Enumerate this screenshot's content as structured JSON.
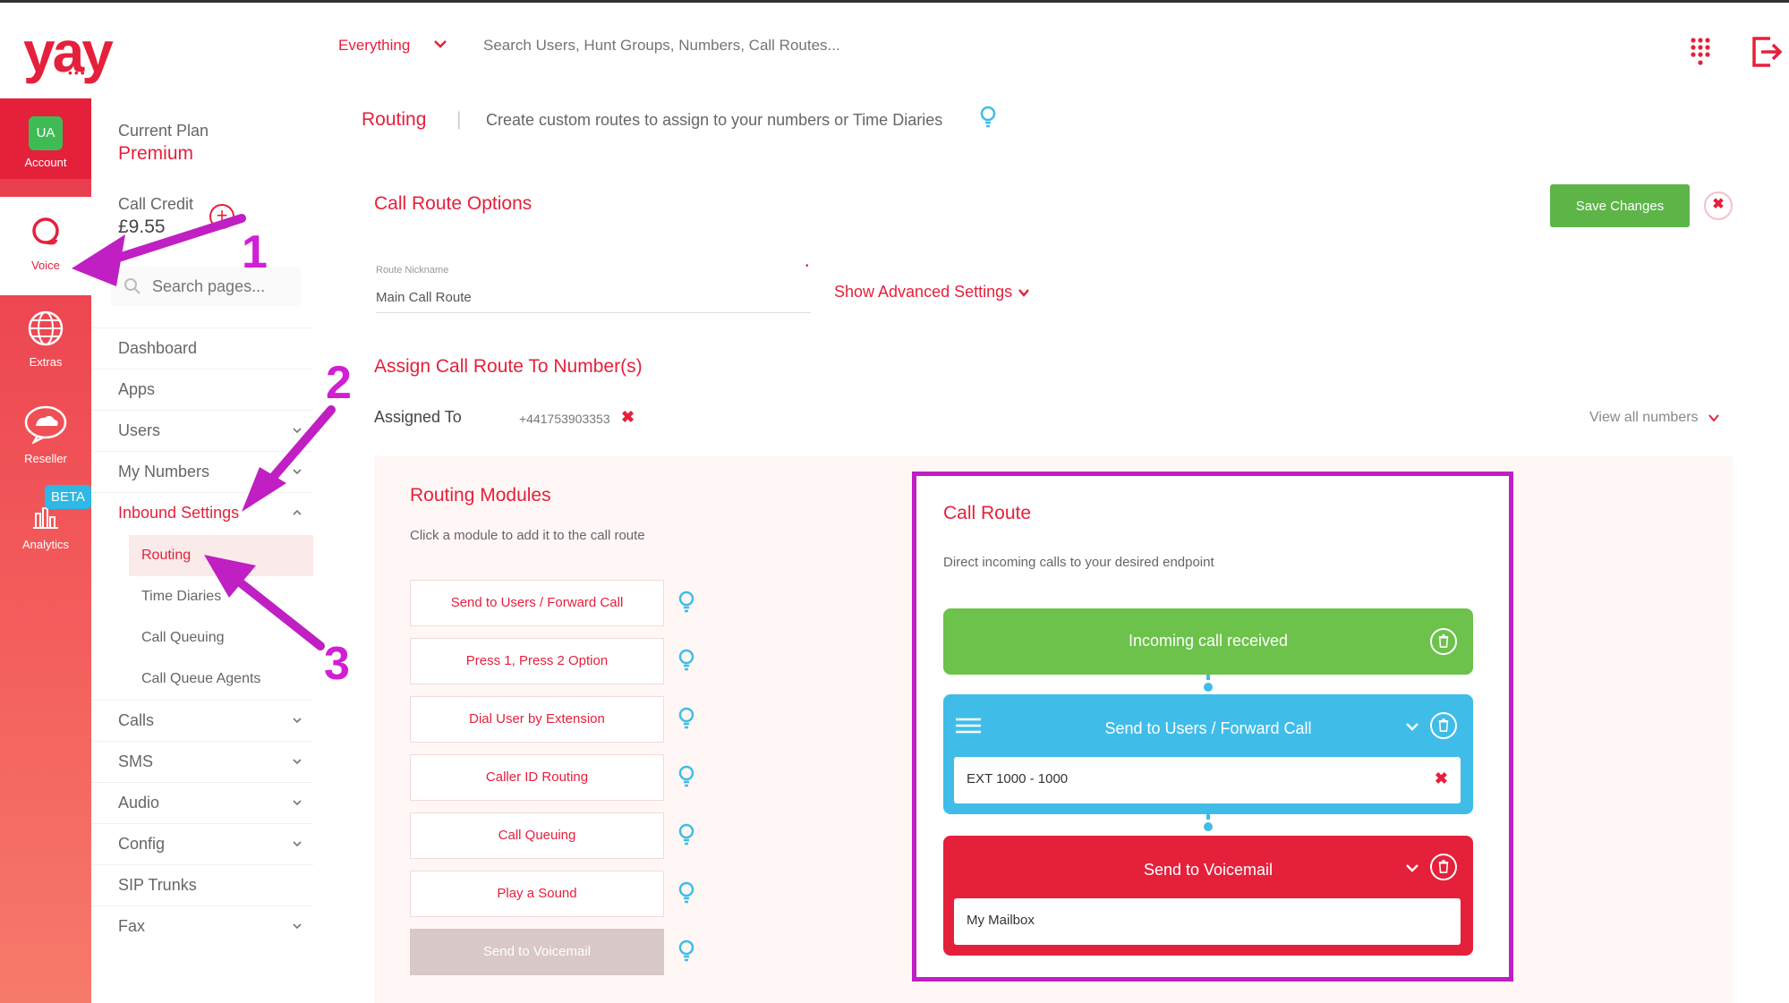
{
  "brand": {
    "name": "yay",
    "dots": "•••",
    "accent": "#e5203b",
    "green": "#5db548",
    "blue": "#3fbde8",
    "annotation": "#c01fc3"
  },
  "topbar": {
    "scope": "Everything",
    "search_placeholder": "Search Users, Hunt Groups, Numbers, Call Routes...",
    "apps_icon": "grid-icon",
    "logout_icon": "logout-icon"
  },
  "rail": {
    "account": {
      "initials": "UA",
      "label": "Account"
    },
    "voice": {
      "label": "Voice"
    },
    "extras": {
      "label": "Extras"
    },
    "reseller": {
      "label": "Reseller"
    },
    "analytics": {
      "label": "Analytics",
      "badge": "BETA"
    }
  },
  "sidebar": {
    "plan_label": "Current Plan",
    "plan_value": "Premium",
    "credit_label": "Call Credit",
    "credit_value": "£9.55",
    "add_credit": "+",
    "search_placeholder": "Search pages...",
    "items": [
      {
        "label": "Dashboard"
      },
      {
        "label": "Apps"
      },
      {
        "label": "Users"
      },
      {
        "label": "My Numbers"
      },
      {
        "label": "Inbound Settings"
      },
      {
        "label": "Calls"
      },
      {
        "label": "SMS"
      },
      {
        "label": "Audio"
      },
      {
        "label": "Config"
      },
      {
        "label": "SIP Trunks"
      },
      {
        "label": "Fax"
      }
    ],
    "subitems": [
      {
        "label": "Routing"
      },
      {
        "label": "Time Diaries"
      },
      {
        "label": "Call Queuing"
      },
      {
        "label": "Call Queue Agents"
      }
    ]
  },
  "header": {
    "page": "Routing",
    "separator": "|",
    "description": "Create custom routes to assign to your numbers or Time Diaries"
  },
  "options": {
    "title": "Call Route Options",
    "save_label": "Save Changes",
    "close_glyph": "✖",
    "nickname_label": "Route Nickname",
    "nickname_value": "Main Call Route",
    "required_mark": "•",
    "advanced_label": "Show Advanced Settings"
  },
  "assign": {
    "title": "Assign Call Route To Number(s)",
    "assigned_label": "Assigned To",
    "number": "+441753903353",
    "remove_glyph": "✖",
    "view_all": "View all numbers"
  },
  "modules": {
    "title": "Routing Modules",
    "description": "Click a module to add it to the call route",
    "items": [
      {
        "label": "Send to Users / Forward Call"
      },
      {
        "label": "Press 1, Press 2 Option"
      },
      {
        "label": "Dial User by Extension"
      },
      {
        "label": "Caller ID Routing"
      },
      {
        "label": "Call Queuing"
      },
      {
        "label": "Play a Sound"
      },
      {
        "label": "Send to Voicemail"
      }
    ]
  },
  "route": {
    "title": "Call Route",
    "description": "Direct incoming calls to your desired endpoint",
    "incoming": "Incoming call received",
    "send_users": "Send to Users / Forward Call",
    "send_users_value": "EXT 1000 - 1000",
    "voicemail": "Send to Voicemail",
    "voicemail_value": "My Mailbox",
    "remove_glyph": "✖"
  },
  "annotations": {
    "one": "1",
    "two": "2",
    "three": "3"
  }
}
